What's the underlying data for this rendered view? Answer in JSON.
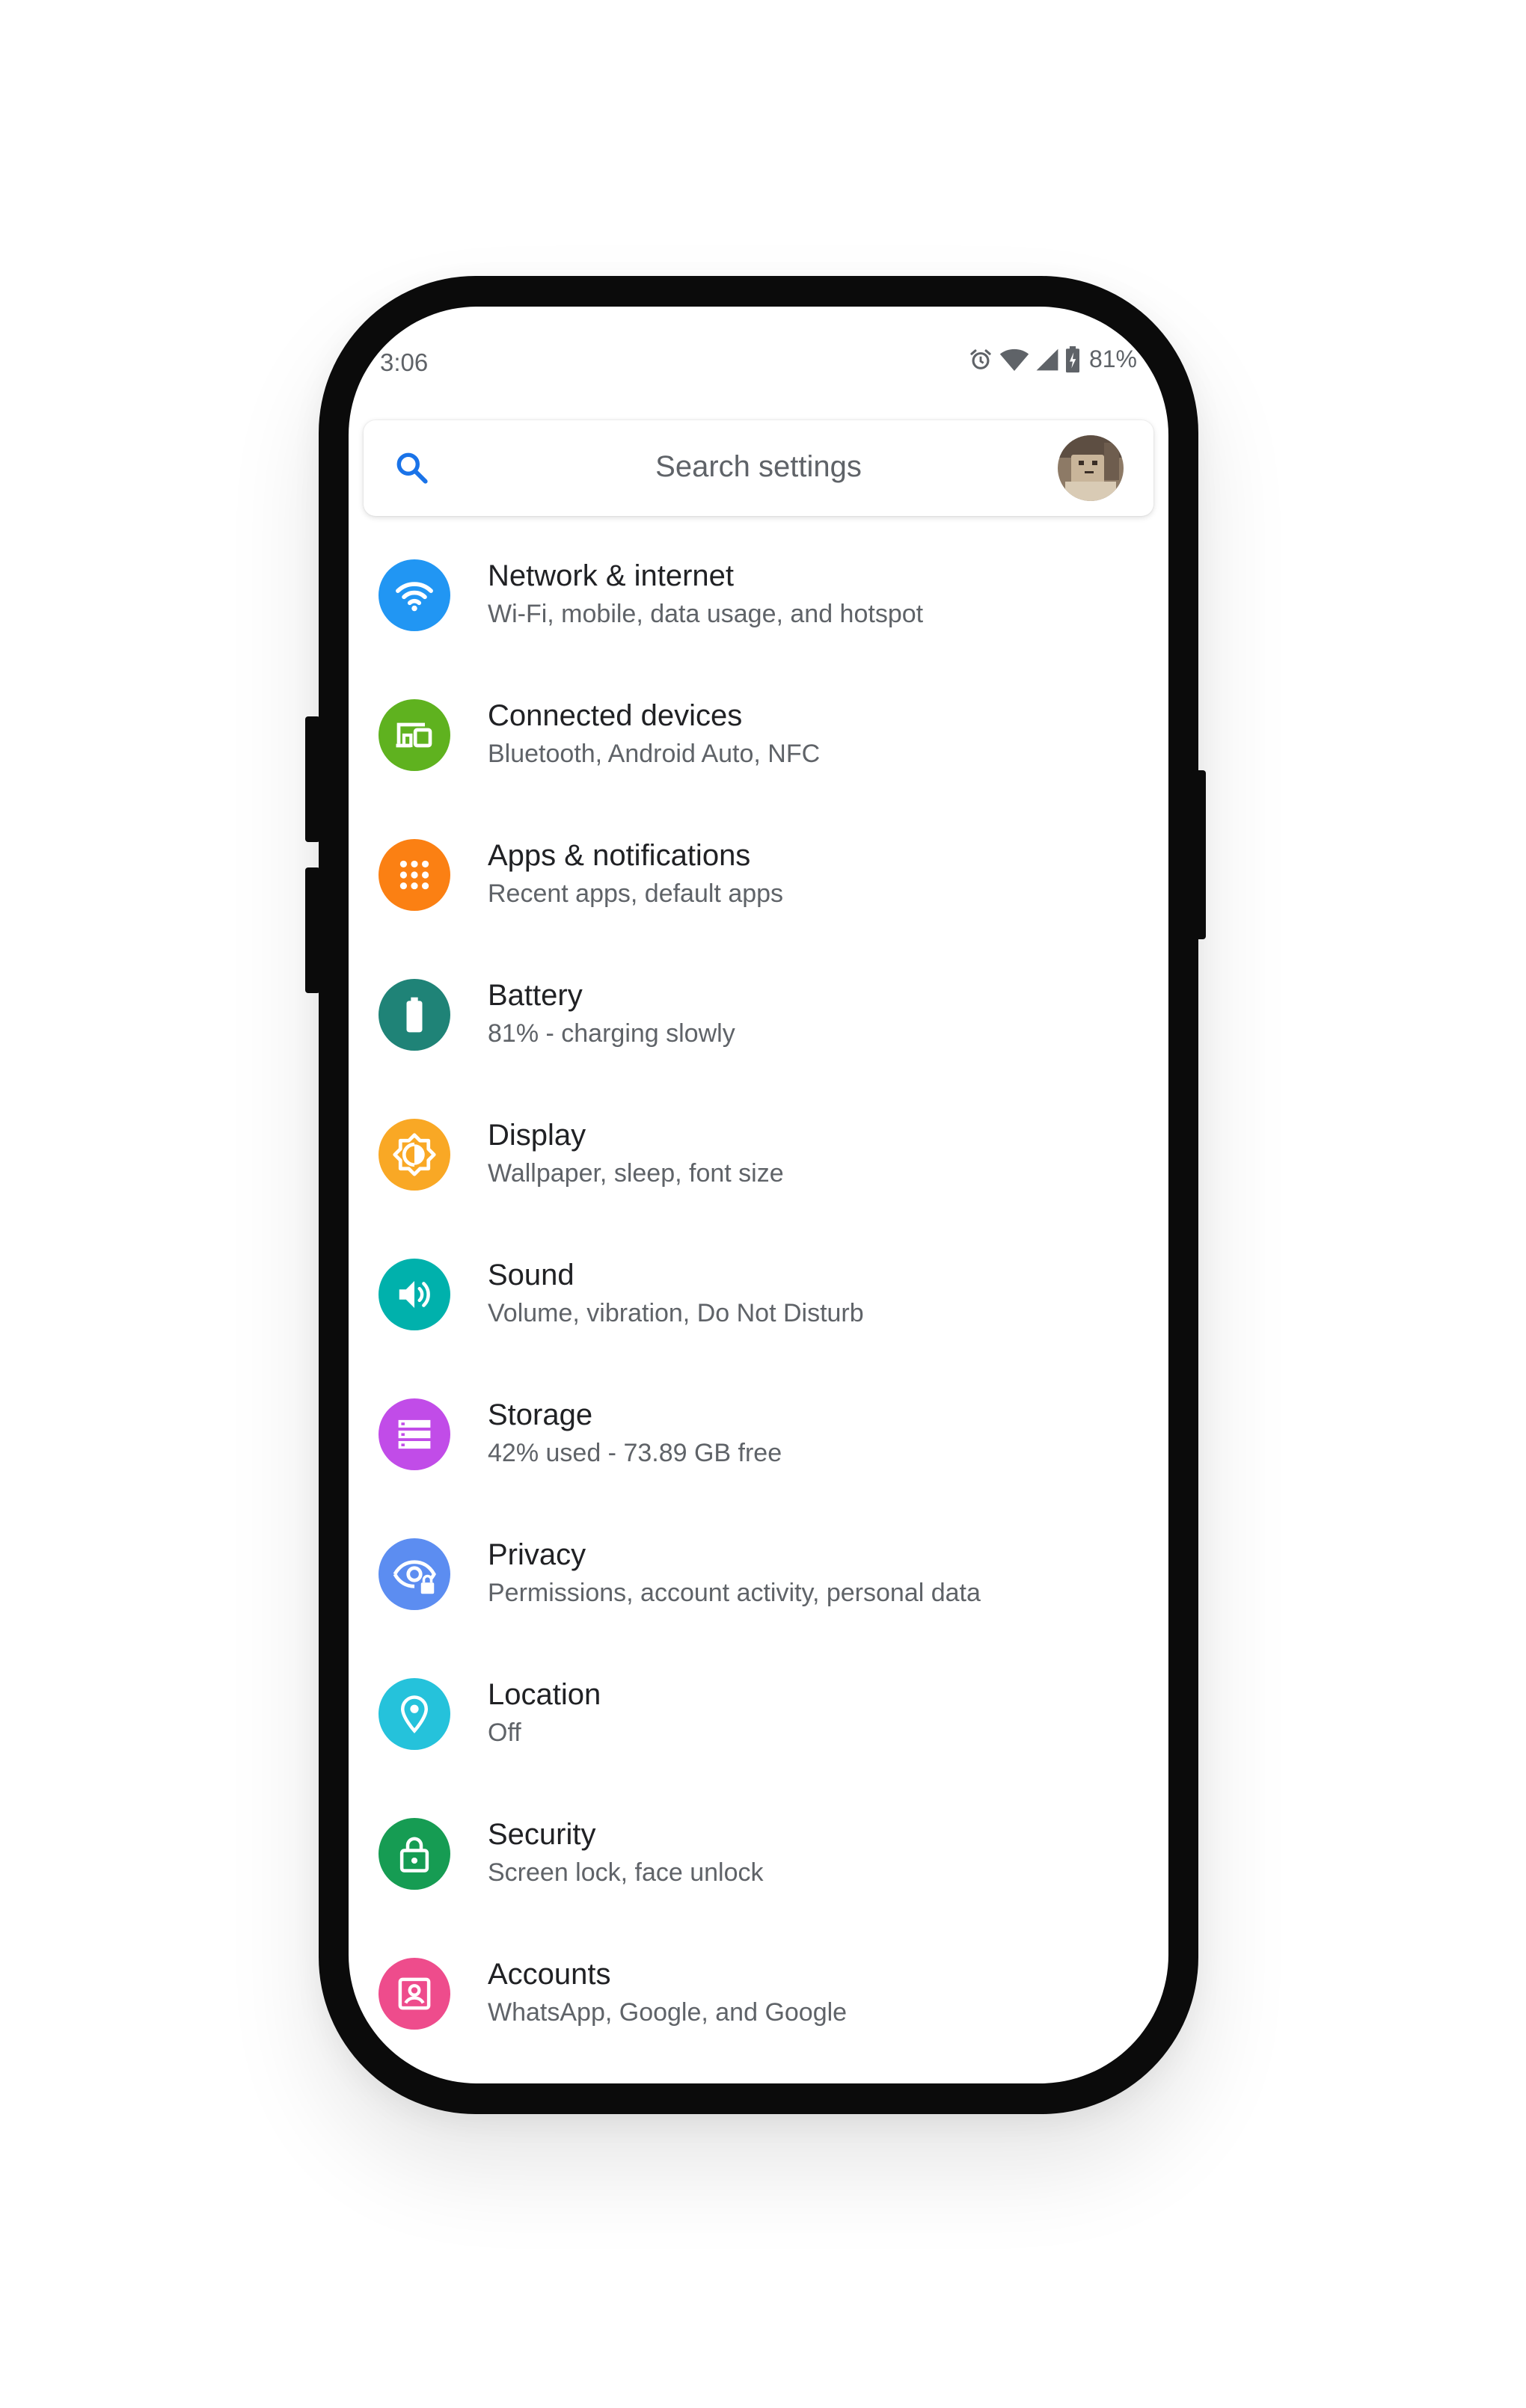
{
  "status_bar": {
    "time": "3:06",
    "battery_percent": "81%",
    "icons": [
      "alarm-icon",
      "wifi-icon",
      "cell-signal-icon",
      "battery-charging-icon"
    ]
  },
  "search": {
    "placeholder": "Search settings",
    "icon": "search-icon"
  },
  "settings": [
    {
      "title": "Network & internet",
      "subtitle": "Wi-Fi, mobile, data usage, and hotspot",
      "icon": "wifi-icon",
      "color": "#2196f3"
    },
    {
      "title": "Connected devices",
      "subtitle": "Bluetooth, Android Auto, NFC",
      "icon": "devices-icon",
      "color": "#5fb21f"
    },
    {
      "title": "Apps & notifications",
      "subtitle": "Recent apps, default apps",
      "icon": "apps-grid-icon",
      "color": "#fb8013"
    },
    {
      "title": "Battery",
      "subtitle": "81% - charging slowly",
      "icon": "battery-icon",
      "color": "#1f8377"
    },
    {
      "title": "Display",
      "subtitle": "Wallpaper, sleep, font size",
      "icon": "brightness-icon",
      "color": "#f9a825"
    },
    {
      "title": "Sound",
      "subtitle": "Volume, vibration, Do Not Disturb",
      "icon": "volume-icon",
      "color": "#00b1ac"
    },
    {
      "title": "Storage",
      "subtitle": "42% used - 73.89 GB free",
      "icon": "storage-icon",
      "color": "#c14ce8"
    },
    {
      "title": "Privacy",
      "subtitle": "Permissions, account activity, personal data",
      "icon": "privacy-eye-icon",
      "color": "#5c8df1"
    },
    {
      "title": "Location",
      "subtitle": "Off",
      "icon": "location-pin-icon",
      "color": "#25c2db"
    },
    {
      "title": "Security",
      "subtitle": "Screen lock, face unlock",
      "icon": "lock-icon",
      "color": "#169c53"
    },
    {
      "title": "Accounts",
      "subtitle": "WhatsApp, Google, and Google",
      "icon": "account-icon",
      "color": "#ee4c8c"
    }
  ]
}
